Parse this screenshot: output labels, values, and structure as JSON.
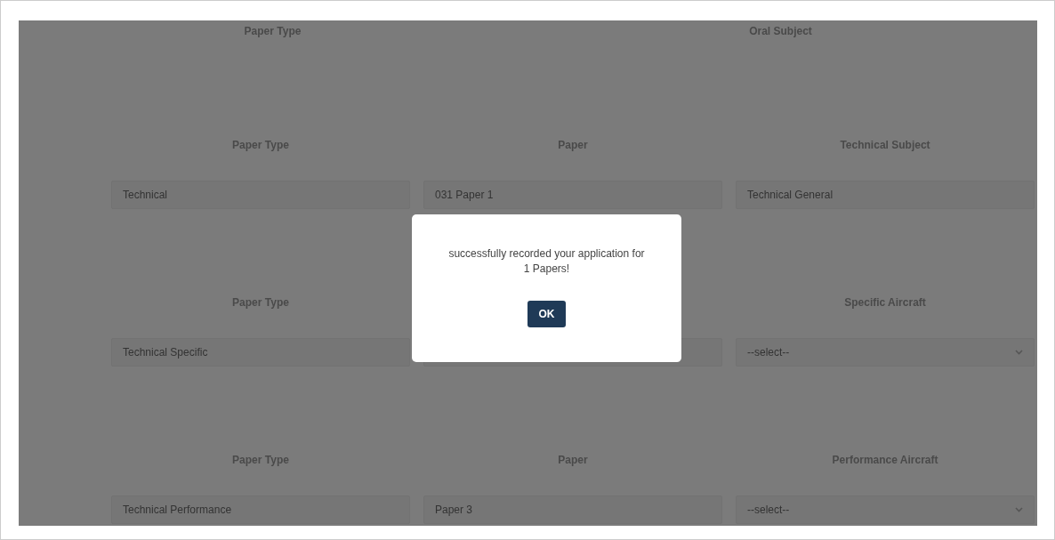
{
  "top_headers": [
    "Paper Type",
    "Oral Subject"
  ],
  "sections": [
    {
      "columns": [
        {
          "header": "Paper Type",
          "kind": "input",
          "value": "Technical"
        },
        {
          "header": "Paper",
          "kind": "input",
          "value": "031 Paper 1"
        },
        {
          "header": "Technical Subject",
          "kind": "input",
          "value": "Technical General"
        }
      ]
    },
    {
      "columns": [
        {
          "header": "Paper Type",
          "kind": "input",
          "value": "Technical Specific"
        },
        {
          "kind": "input"
        },
        {
          "header": "Specific Aircraft",
          "kind": "select",
          "value": "--select--"
        }
      ]
    },
    {
      "columns": [
        {
          "header": "Paper Type",
          "kind": "input",
          "value": "Technical Performance"
        },
        {
          "header": "Paper",
          "kind": "input",
          "value": "Paper 3"
        },
        {
          "header": "Performance Aircraft",
          "kind": "select",
          "value": "--select--"
        }
      ]
    }
  ],
  "dialog": {
    "message": "successfully recorded your application for 1 Papers!",
    "button": "OK"
  }
}
